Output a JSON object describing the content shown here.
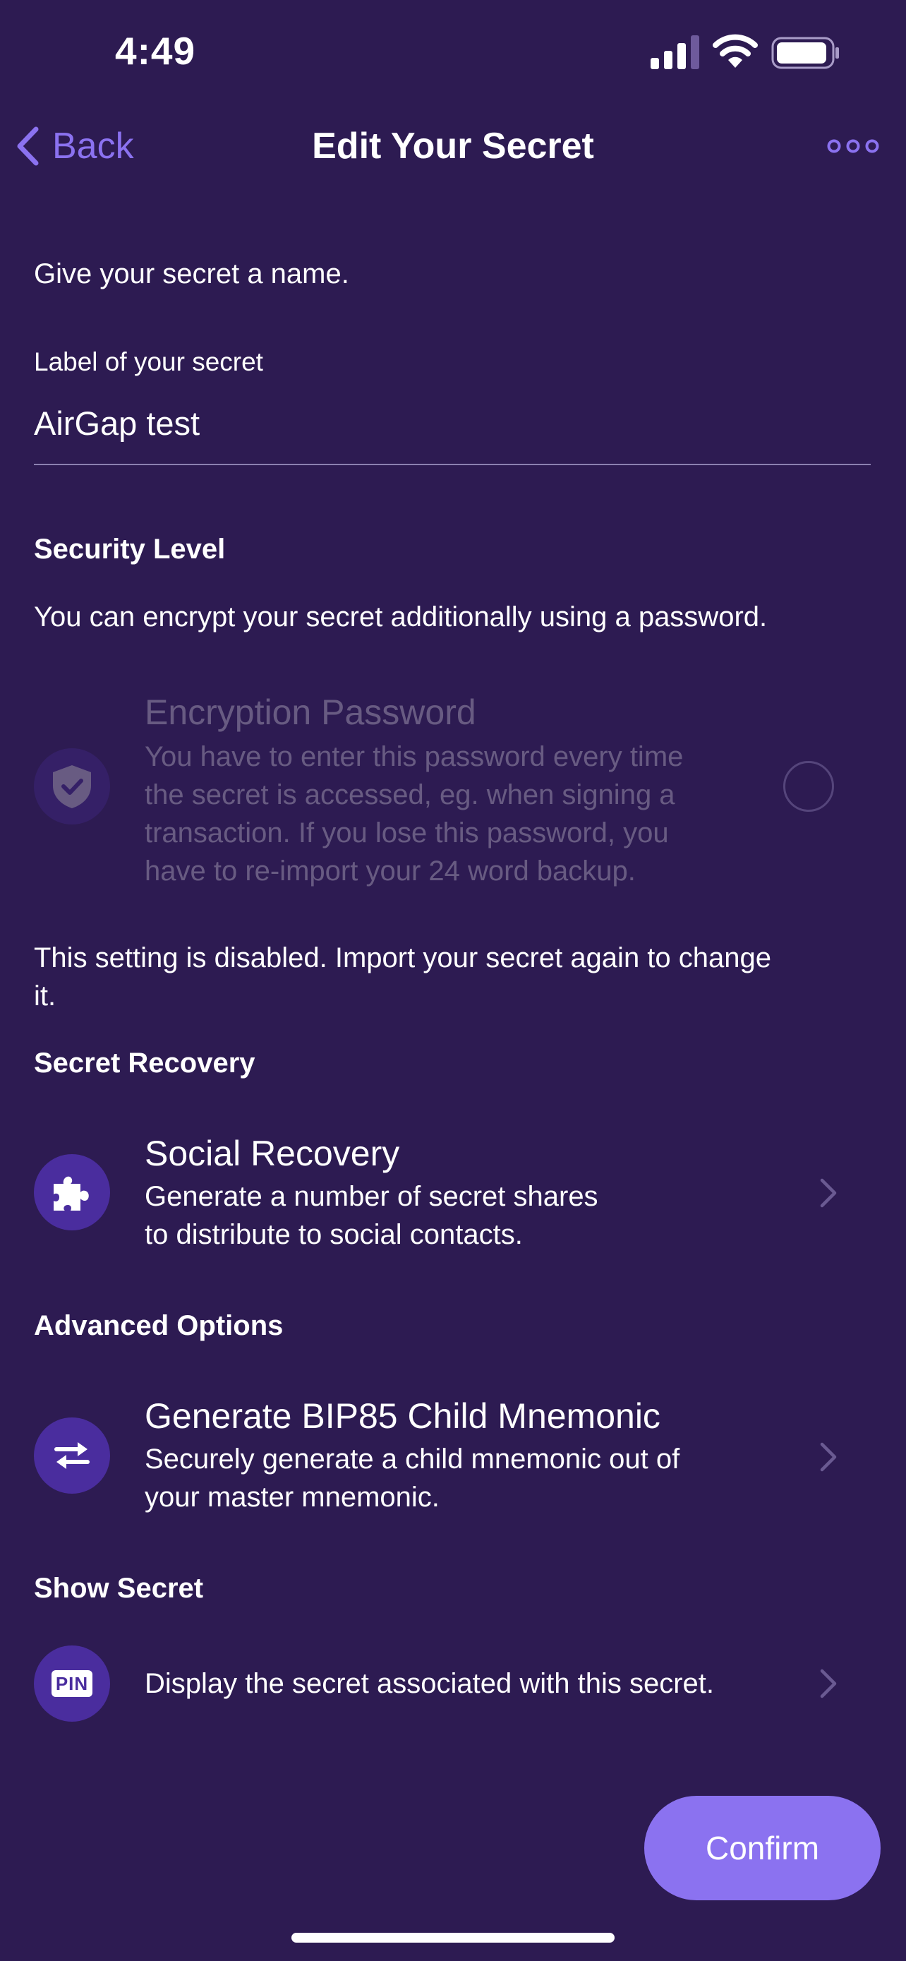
{
  "status_bar": {
    "time": "4:49"
  },
  "nav": {
    "back_label": "Back",
    "title": "Edit Your Secret"
  },
  "name_section": {
    "prompt": "Give your secret a name.",
    "field_label": "Label of your secret",
    "field_value": "AirGap test"
  },
  "security": {
    "heading": "Security Level",
    "description": "You can encrypt your secret additionally using a password.",
    "encryption_title": "Encryption Password",
    "encryption_desc_lines": [
      "You have to enter this password every time",
      "the secret is accessed, eg. when signing a",
      "transaction. If you lose this password, you",
      "have to re-import your 24 word backup."
    ],
    "disabled_note_lines": [
      "This setting is disabled. Import your secret again to change",
      "it."
    ]
  },
  "recovery": {
    "heading": "Secret Recovery",
    "title": "Social Recovery",
    "desc_lines": [
      "Generate a number of secret shares",
      "to distribute to social contacts."
    ]
  },
  "advanced": {
    "heading": "Advanced Options",
    "title": "Generate BIP85 Child Mnemonic",
    "desc_lines": [
      "Securely generate a child mnemonic out of",
      "your master mnemonic."
    ]
  },
  "show_secret": {
    "heading": "Show Secret",
    "icon_text": "PIN",
    "description": "Display the secret associated with this secret."
  },
  "confirm_label": "Confirm",
  "colors": {
    "background": "#2d1b52",
    "accent": "#8b72f0",
    "icon_bg": "#4a2d9e"
  }
}
